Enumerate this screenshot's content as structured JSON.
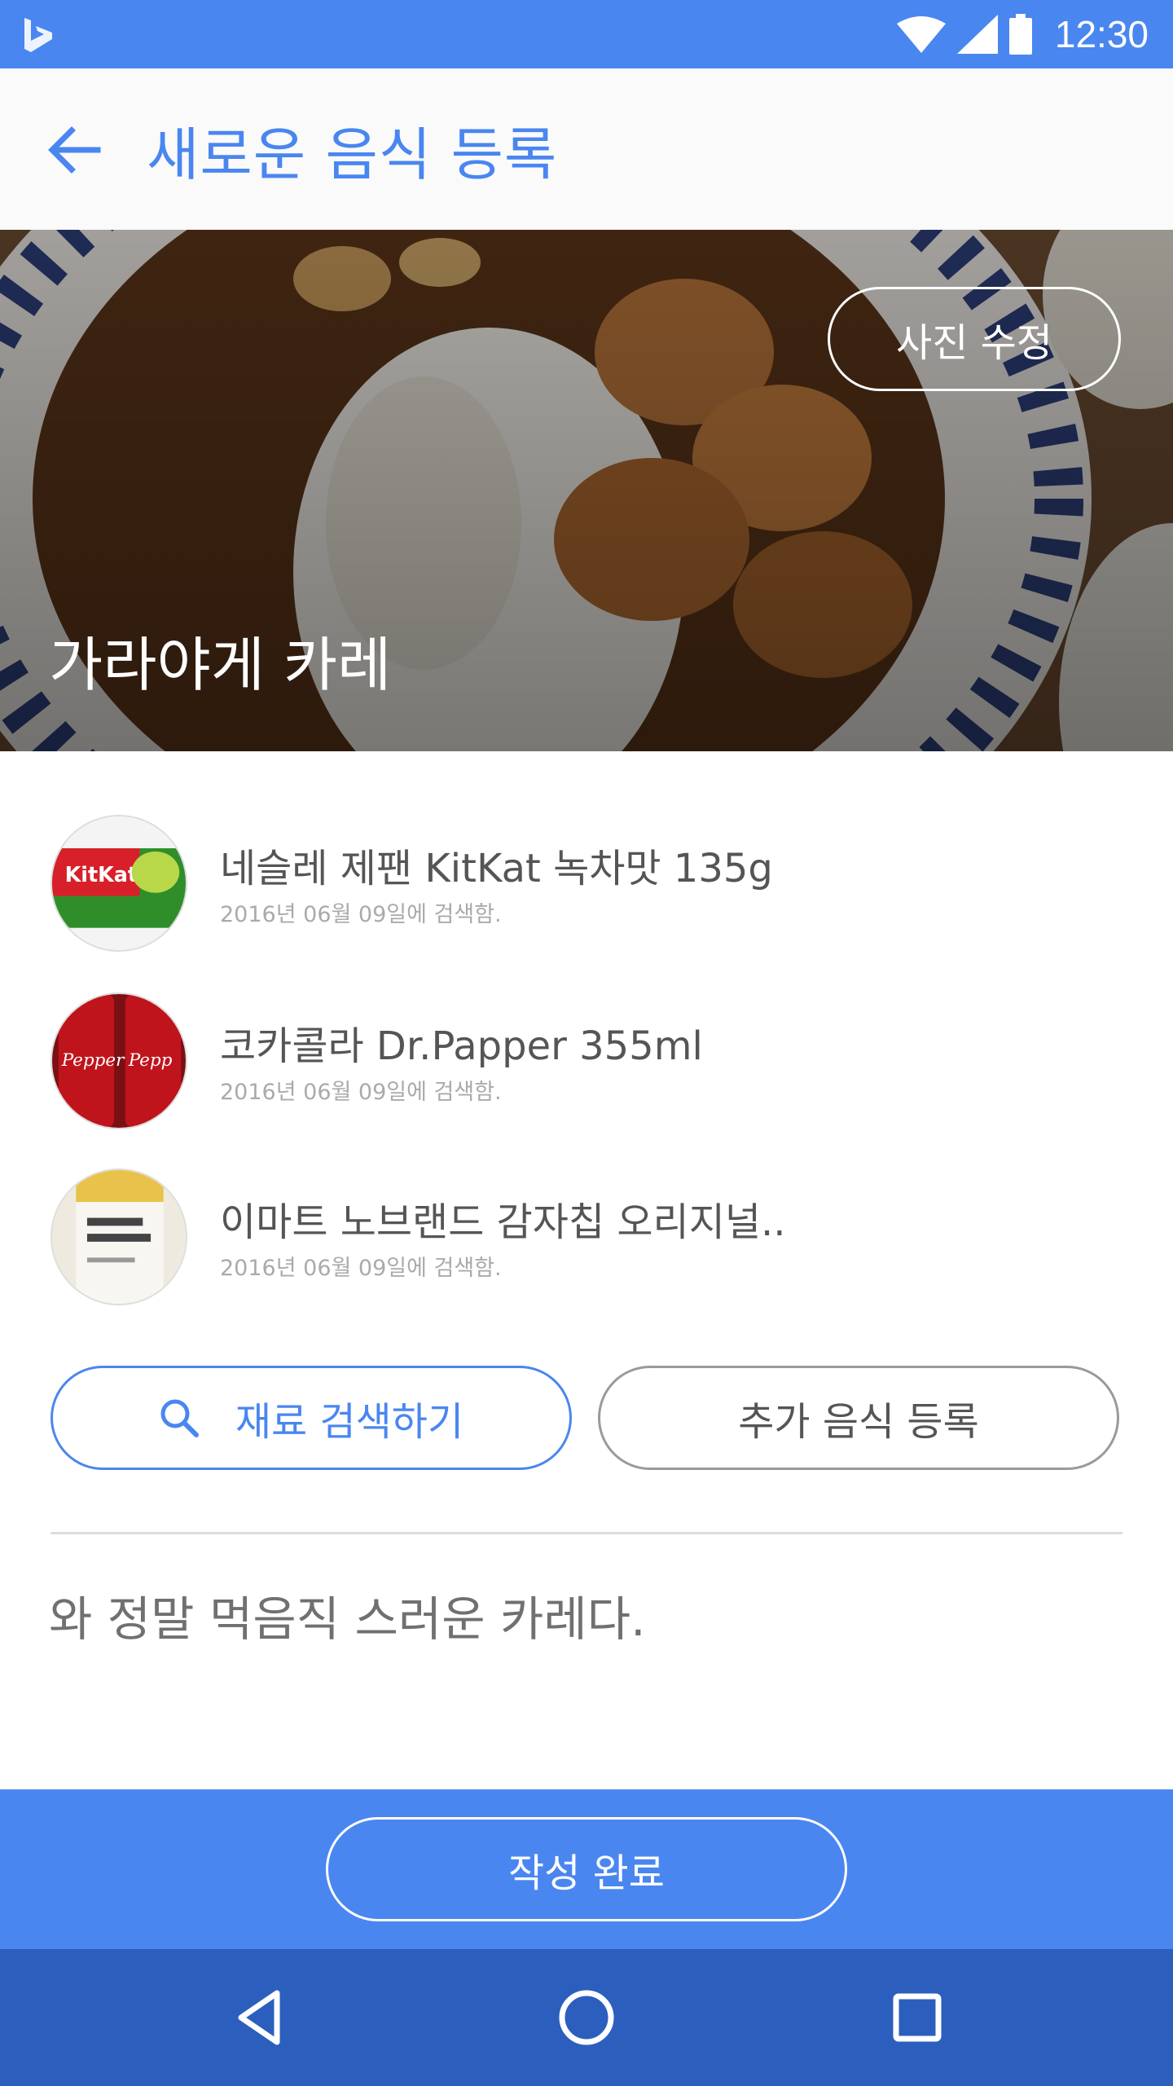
{
  "colors": {
    "primary": "#4a86f0",
    "nav_dark": "#2c5fbd",
    "text_gray": "#555555",
    "date_gray": "#aaaaaa"
  },
  "status_bar": {
    "time": "12:30",
    "icons": [
      "app-logo-icon",
      "wifi-icon",
      "signal-icon",
      "battery-icon"
    ]
  },
  "header": {
    "title": "새로운 음식 등록",
    "back_icon": "arrow-left-icon"
  },
  "hero": {
    "edit_photo_label": "사진 수정",
    "dish_name": "가라야게 카레"
  },
  "items": [
    {
      "title": "네슬레 제팬 KitKat 녹차맛 135g",
      "date": "2016년 06월 09일에 검색함.",
      "image": "kitkat-thumbnail"
    },
    {
      "title": "코카콜라 Dr.Papper 355ml",
      "date": "2016년 06월 09일에 검색함.",
      "image": "dr-pepper-thumbnail"
    },
    {
      "title": "이마트 노브랜드 감자칩 오리지널..",
      "date": "2016년 06월 09일에 검색함.",
      "image": "potato-chip-thumbnail"
    }
  ],
  "actions": {
    "search_label": "재료 검색하기",
    "add_label": "추가 음식 등록"
  },
  "comment": "와 정말 먹음직 스러운 카레다.",
  "footer": {
    "submit_label": "작성 완료"
  },
  "nav": {
    "icons": [
      "back-triangle-icon",
      "home-circle-icon",
      "recents-square-icon"
    ]
  }
}
